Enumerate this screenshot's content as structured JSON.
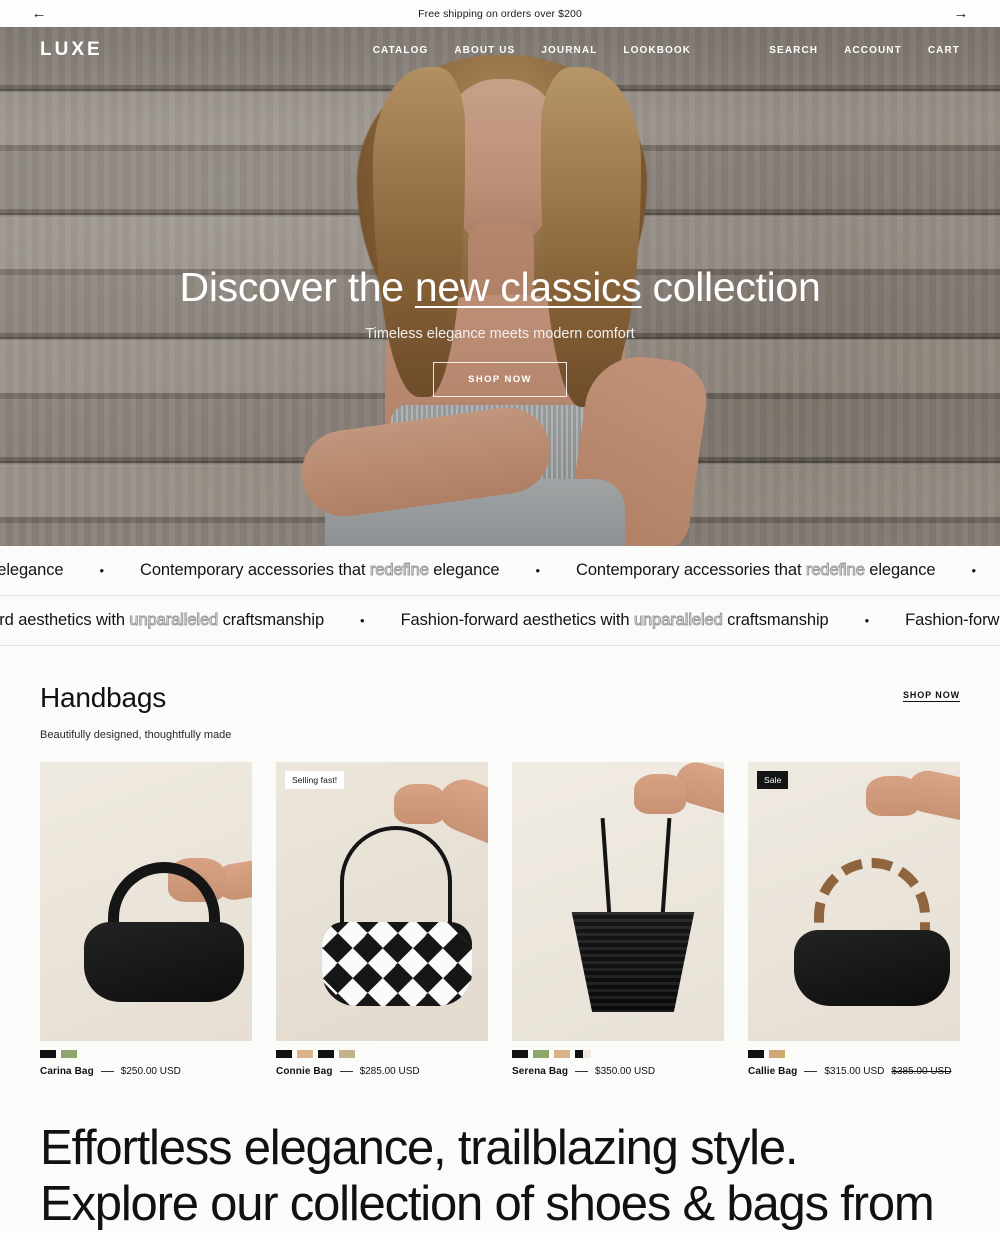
{
  "announcement": {
    "prev_icon": "arrow-left-icon",
    "prev_glyph": "←",
    "text": "Free shipping on orders over $200",
    "next_icon": "arrow-right-icon",
    "next_glyph": "→"
  },
  "header": {
    "logo": "LUXE",
    "nav": [
      {
        "label": "CATALOG"
      },
      {
        "label": "ABOUT US"
      },
      {
        "label": "JOURNAL"
      },
      {
        "label": "LOOKBOOK"
      }
    ],
    "utility": [
      {
        "label": "SEARCH",
        "icon": "search-icon"
      },
      {
        "label": "ACCOUNT",
        "icon": "account-icon"
      },
      {
        "label": "CART",
        "icon": "cart-icon"
      }
    ]
  },
  "hero": {
    "title_before": "Discover the ",
    "title_underlined": "new classics",
    "title_after": " collection",
    "subtitle": "Timeless elegance meets modern comfort",
    "cta": "SHOP NOW"
  },
  "marquee": {
    "row1": {
      "plain_tail": "egance",
      "text_before": "Contemporary accessories that ",
      "text_outline": "redefine",
      "text_after": " elegance",
      "separator": "•"
    },
    "row2": {
      "outline_tail": "unparalleled",
      "plain_tail": " craftsmanship",
      "text_before": "Fashion-forward aesthetics with ",
      "text_outline": "unparalleled",
      "text_after": " craftsmanship",
      "text_truncated": "Fashion-forward aest",
      "separator": "•"
    }
  },
  "collection": {
    "title": "Handbags",
    "subtitle": "Beautifully designed, thoughtfully made",
    "link": "SHOP NOW",
    "products": [
      {
        "name": "Carina Bag",
        "price": "$250.00 USD",
        "compare_at": "",
        "badge": "",
        "badge_style": "",
        "swatches": [
          "#111111",
          "#8da86a"
        ]
      },
      {
        "name": "Connie Bag",
        "price": "$285.00 USD",
        "compare_at": "",
        "badge": "Selling fast!",
        "badge_style": "light",
        "swatches": [
          "#111111",
          "#d9b488",
          "#111111",
          "#c2b189"
        ]
      },
      {
        "name": "Serena Bag",
        "price": "$350.00 USD",
        "compare_at": "",
        "badge": "",
        "badge_style": "",
        "swatches": [
          "#111111",
          "#8da86a",
          "#d9b488",
          "split"
        ]
      },
      {
        "name": "Callie Bag",
        "price": "$315.00 USD",
        "compare_at": "$385.00 USD",
        "badge": "Sale",
        "badge_style": "dark",
        "swatches": [
          "#111111",
          "#d0a874"
        ]
      }
    ]
  },
  "statement": {
    "line1": "Effortless elegance, trailblazing style.",
    "line2": "Explore our collection of shoes & bags from"
  },
  "colors": {
    "page_bg": "#fbfbfa",
    "text": "#111111",
    "badge_dark_bg": "#141414",
    "outline_stroke": "#9b9b9b"
  }
}
